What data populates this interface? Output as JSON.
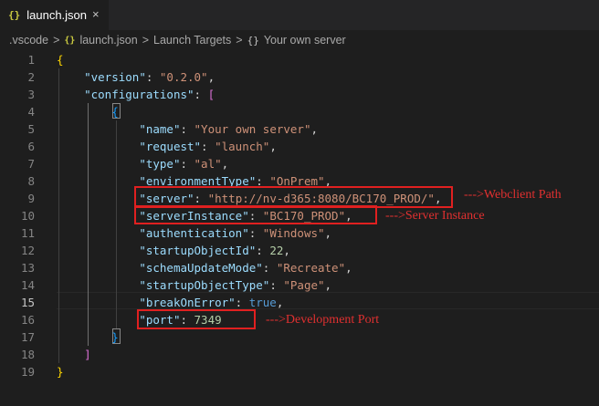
{
  "tab": {
    "icon": "json-braces-icon",
    "title": "launch.json",
    "close": "×"
  },
  "breadcrumb": {
    "items": [
      ".vscode",
      "launch.json",
      "Launch Targets",
      "Your own server"
    ],
    "separator": ">",
    "object_icon": "{}"
  },
  "editor": {
    "active_line": 15,
    "lines": [
      {
        "n": "1"
      },
      {
        "n": "2"
      },
      {
        "n": "3"
      },
      {
        "n": "4"
      },
      {
        "n": "5"
      },
      {
        "n": "6"
      },
      {
        "n": "7"
      },
      {
        "n": "8"
      },
      {
        "n": "9"
      },
      {
        "n": "10"
      },
      {
        "n": "11"
      },
      {
        "n": "12"
      },
      {
        "n": "13"
      },
      {
        "n": "14"
      },
      {
        "n": "15"
      },
      {
        "n": "16"
      },
      {
        "n": "17"
      },
      {
        "n": "18"
      },
      {
        "n": "19"
      }
    ],
    "tokens": {
      "open_root": "{",
      "version_key": "\"version\"",
      "version_val": "\"0.2.0\"",
      "configurations_key": "\"configurations\"",
      "array_open": "[",
      "obj_open": "{",
      "name_key": "\"name\"",
      "name_val": "\"Your own server\"",
      "request_key": "\"request\"",
      "request_val": "\"launch\"",
      "type_key": "\"type\"",
      "type_val": "\"al\"",
      "env_key": "\"environmentType\"",
      "env_val": "\"OnPrem\"",
      "server_key": "\"server\"",
      "server_val": "\"http://nv-d365:8080/BC170_PROD/\"",
      "instance_key": "\"serverInstance\"",
      "instance_val": "\"BC170_PROD\"",
      "auth_key": "\"authentication\"",
      "auth_val": "\"Windows\"",
      "startup_id_key": "\"startupObjectId\"",
      "startup_id_val": "22",
      "schema_key": "\"schemaUpdateMode\"",
      "schema_val": "\"Recreate\"",
      "startup_type_key": "\"startupObjectType\"",
      "startup_type_val": "\"Page\"",
      "break_key": "\"breakOnError\"",
      "break_val": "true",
      "port_key": "\"port\"",
      "port_val": "7349",
      "obj_close": "}",
      "array_close": "]",
      "close_root": "}",
      "colon": ": ",
      "comma": ","
    }
  },
  "annotations": {
    "webclient": "--->Webclient Path",
    "server_instance": "--->Server Instance",
    "dev_port": "--->Development Port"
  },
  "colors": {
    "background": "#1e1e1e",
    "key": "#9cdcfe",
    "string": "#ce9178",
    "number": "#b5cea8",
    "keyword": "#569cd6",
    "annotation": "#e02020"
  }
}
